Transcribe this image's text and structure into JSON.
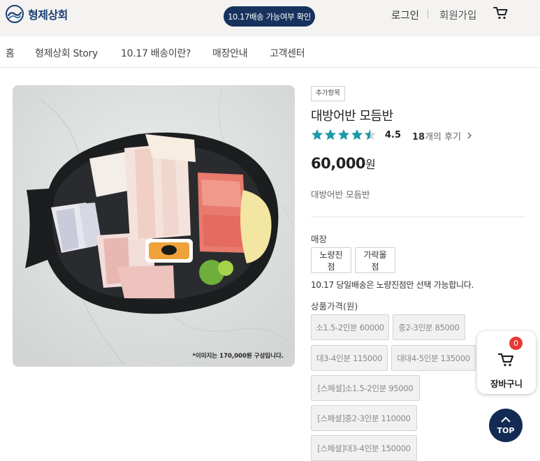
{
  "header": {
    "logo_text": "형제상회",
    "delivery_check_label": "10.17배송 가능여부 확인",
    "login_label": "로그인",
    "signup_label": "회원가입"
  },
  "nav": {
    "items": [
      "홈",
      "형제상회 Story",
      "10.17 배송이란?",
      "매장안내",
      "고객센터"
    ]
  },
  "product": {
    "image_caption": "*이미지는 170,000원 구성입니다.",
    "tag": "추가항목",
    "title": "대방어반 모듬반",
    "rating": "4.5",
    "rating_value": 4.5,
    "review_count": "18",
    "review_suffix": "개의 후기",
    "price": "60,000",
    "price_unit": "원",
    "description": "대방어반 모듬반"
  },
  "store_section": {
    "label": "매장",
    "options": [
      "노량진점",
      "가락몰점"
    ],
    "notice": "10.17 당일배송은 노량진점만 선택 가능합니다."
  },
  "price_section": {
    "label": "상품가격(원)",
    "options": [
      "소1.5-2인분 60000",
      "중2-3인분 85000",
      "대3-4인분 115000",
      "대대4-5인분 135000",
      "[스페셜]소1.5-2인분 95000",
      "[스페셜]중2-3인분 110000",
      "[스페셜]대3-4인분 150000"
    ]
  },
  "floating_cart": {
    "count": "0",
    "label": "장바구니"
  },
  "top_button": {
    "label": "TOP"
  },
  "colors": {
    "brand_navy": "#17325d",
    "star_teal": "#1b9aaa",
    "badge_red": "#e53935",
    "topbar_bg": "#f4f3f1"
  }
}
